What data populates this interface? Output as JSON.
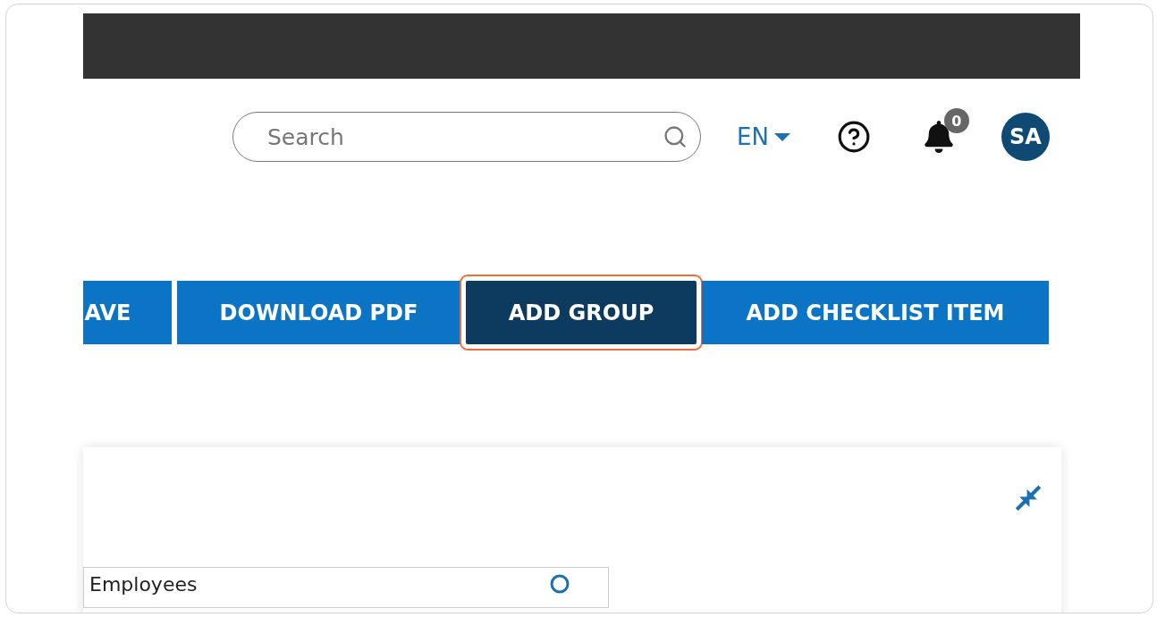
{
  "header": {
    "search": {
      "placeholder": "Search"
    },
    "language": "EN",
    "notifications": {
      "count": "0"
    },
    "avatar": "SA"
  },
  "actions": [
    {
      "label": "AVE",
      "selected": false
    },
    {
      "label": "DOWNLOAD PDF",
      "selected": false
    },
    {
      "label": "ADD GROUP",
      "selected": true
    },
    {
      "label": "ADD CHECKLIST ITEM",
      "selected": false
    }
  ],
  "panel": {
    "field": {
      "value": "Employees"
    }
  }
}
